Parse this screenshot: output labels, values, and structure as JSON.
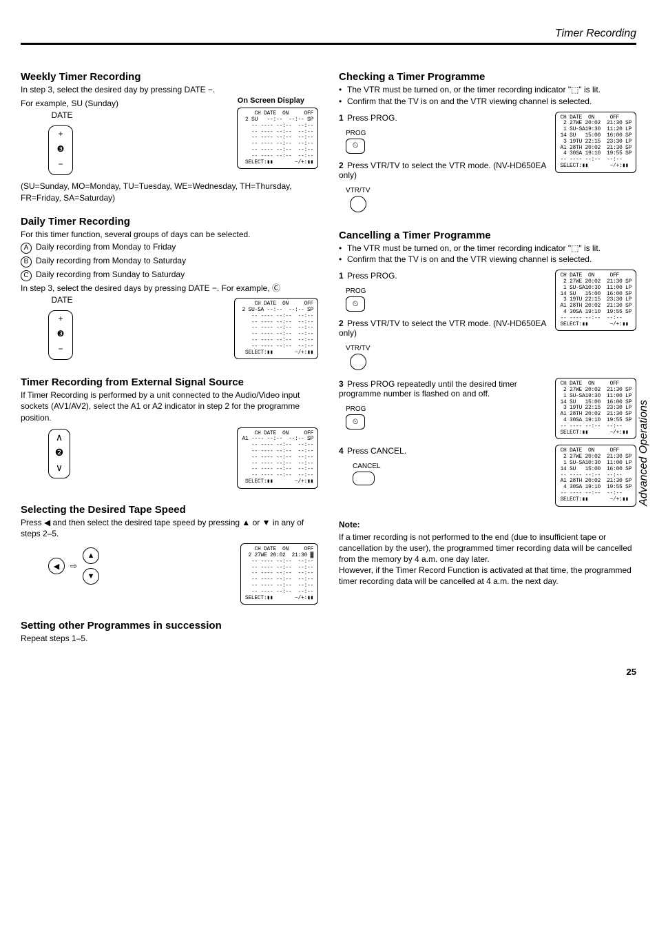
{
  "header": {
    "title": "Timer Recording"
  },
  "sideTab": "Advanced Operations",
  "pageNumber": "25",
  "left": {
    "weekly": {
      "heading": "Weekly Timer Recording",
      "p1": "In step 3, select the desired day by pressing DATE −.",
      "p2": "For example, SU (Sunday)",
      "osdLabel": "On Screen Display",
      "dateLabel": "DATE",
      "dateWidget": {
        "plus": "+",
        "mid": "❸",
        "minus": "−"
      },
      "osd": "CH DATE  ON     OFF\n 2 SU   --:--  --:-- SP\n-- ---- --:--  --:--\n-- ---- --:--  --:--\n-- ---- --:--  --:--\n-- ---- --:--  --:--\n-- ---- --:--  --:--\n-- ---- --:--  --:--\nSELECT:▮▮       −/+:▮▮",
      "legend": "(SU=Sunday, MO=Monday, TU=Tuesday, WE=Wednesday, TH=Thursday, FR=Friday, SA=Saturday)"
    },
    "daily": {
      "heading": "Daily Timer Recording",
      "intro": "For this timer function, several groups of days can be selected.",
      "itemA": "Daily recording from Monday to Friday",
      "itemB": "Daily recording from Monday to Saturday",
      "itemC": "Daily recording from Sunday to Saturday",
      "p3": "In step 3, select the desired days by pressing DATE −. For example, Ⓒ",
      "dateLabel": "DATE",
      "dateWidget": {
        "plus": "+",
        "mid": "❸",
        "minus": "−"
      },
      "osd": "CH DATE  ON     OFF\n 2 SU-SA --:--  --:-- SP\n-- ---- --:--  --:--\n-- ---- --:--  --:--\n-- ---- --:--  --:--\n-- ---- --:--  --:--\n-- ---- --:--  --:--\n-- ---- --:--  --:--\nSELECT:▮▮       −/+:▮▮"
    },
    "external": {
      "heading": "Timer Recording from External Signal Source",
      "p": "If Timer Recording is performed by a unit connected to the Audio/Video input sockets (AV1/AV2), select the A1 or A2 indicator in step 2 for the programme position.",
      "updown": {
        "up": "∧",
        "mid": "❷",
        "down": "∨"
      },
      "osd": "CH DATE  ON     OFF\nA1 ---- --:--  --:-- SP\n-- ---- --:--  --:--\n-- ---- --:--  --:--\n-- ---- --:--  --:--\n-- ---- --:--  --:--\n-- ---- --:--  --:--\n-- ---- --:--  --:--\nSELECT:▮▮       −/+:▮▮"
    },
    "tapeSpeed": {
      "heading": "Selecting the Desired Tape Speed",
      "p": "Press ◀ and then select the desired tape speed by pressing ▲ or ▼ in any of steps 2–5.",
      "arrows": {
        "left": "◀",
        "up": "▲",
        "down": "▼"
      },
      "osd": "CH DATE  ON     OFF\n 2 27WE 20:02  21:30 ▓\n-- ---- --:--  --:--\n-- ---- --:--  --:--\n-- ---- --:--  --:--\n-- ---- --:--  --:--\n-- ---- --:--  --:--\n-- ---- --:--  --:--\nSELECT:▮▮       −/+:▮▮"
    },
    "succession": {
      "heading": "Setting other Programmes in succession",
      "p": "Repeat steps 1–5."
    }
  },
  "right": {
    "checking": {
      "heading": "Checking a Timer Programme",
      "b1": "The VTR must be turned on, or the timer recording indicator \"⬚\" is lit.",
      "b2": "Confirm that the TV is on and the VTR viewing channel is selected.",
      "step1": "Press PROG.",
      "progLabel": "PROG",
      "step2": "Press VTR/TV to select the VTR mode. (NV-HD650EA only)",
      "vtrLabel": "VTR/TV",
      "osd": "CH DATE  ON     OFF\n 2 27WE 20:02  21:30 SP\n 1 SU-SA19:30  11:20 LP\n14 SU   15:00  16:00 SP\n 3 19TU 22:15  23:30 LP\nA1 28TH 20:02  21:30 SP\n 4 30SA 19:10  19:55 SP\n-- ---- --:--  --:--\nSELECT:▮▮       −/+:▮▮"
    },
    "cancel": {
      "heading": "Cancelling a Timer Programme",
      "b1": "The VTR must be turned on, or the timer recording indicator \"⬚\" is lit.",
      "b2": "Confirm that the TV is on and the VTR viewing channel is selected.",
      "step1": "Press PROG.",
      "progLabel": "PROG",
      "osd1": "CH DATE  ON     OFF\n 2 27WE 20:02  21:30 SP\n 1 SU-SA10:30  11:00 LP\n14 SU   15:00  16:00 SP\n 3 19TU 22:15  23:30 LP\nA1 28TH 20:02  21:30 SP\n 4 30SA 19:10  19:55 SP\n-- ---- --:--  --:--\nSELECT:▮▮       −/+:▮▮",
      "step2": "Press VTR/TV to select the VTR mode. (NV-HD650EA only)",
      "vtrLabel": "VTR/TV",
      "step3": "Press PROG repeatedly until the desired timer programme number is flashed on and off.",
      "osd3": "CH DATE  ON     OFF\n 2 27WE 20:02  21:30 SP\n 1 SU-SA19:30  11:00 LP\n14 SU   15:00  16:00 SP\n 3 19TU 22:15  23:30 LP\nA1 28TH 20:02  21:30 SP\n 4 30SA 19:10  19:55 SP\n-- ---- --:--  --:--\nSELECT:▮▮       −/+:▮▮",
      "step4": "Press CANCEL.",
      "cancelLabel": "CANCEL",
      "osd4": "CH DATE  ON     OFF\n 2 27WE 20:02  21:30 SP\n 1 SU-SA10:30  11:00 LP\n14 SU   15:00  16:00 SP\n-- ---- --:--  --:--\nA1 28TH 20:02  21:30 SP\n 4 30SA 19:10  19:55 SP\n-- ---- --:--  --:--\nSELECT:▮▮       −/+:▮▮",
      "noteH": "Note:",
      "noteP": "If a timer recording is not performed to the end (due to insufficient tape or cancellation by the user), the programmed timer recording data will be cancelled from the memory by 4 a.m. one day later.\nHowever, if the Timer Record Function is activated at that time, the programmed timer recording data will be cancelled at 4 a.m. the next day."
    }
  }
}
